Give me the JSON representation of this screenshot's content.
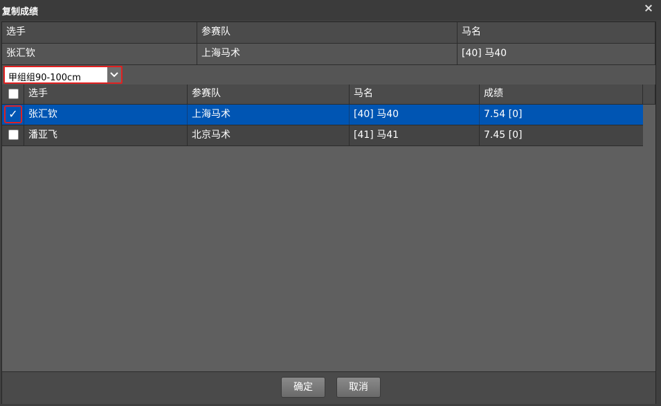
{
  "dialog": {
    "title": "复制成绩",
    "close_glyph": "×"
  },
  "source": {
    "headers": [
      "选手",
      "参赛队",
      "马名"
    ],
    "row": [
      "张汇钦",
      "上海马术",
      "[40] 马40"
    ]
  },
  "group_select": {
    "value": "甲组组90-100cm"
  },
  "list": {
    "headers": [
      "选手",
      "参赛队",
      "马名",
      "成绩"
    ],
    "rows": [
      {
        "checked": true,
        "rider": "张汇钦",
        "team": "上海马术",
        "horse": "[40] 马40",
        "score": "7.54 [0]"
      },
      {
        "checked": false,
        "rider": "潘亚飞",
        "team": "北京马术",
        "horse": "[41] 马41",
        "score": "7.45 [0]"
      }
    ]
  },
  "footer": {
    "ok_label": "确定",
    "cancel_label": "取消"
  },
  "colors": {
    "selected_row": "#0055b3",
    "highlight_outline": "#e02020"
  }
}
